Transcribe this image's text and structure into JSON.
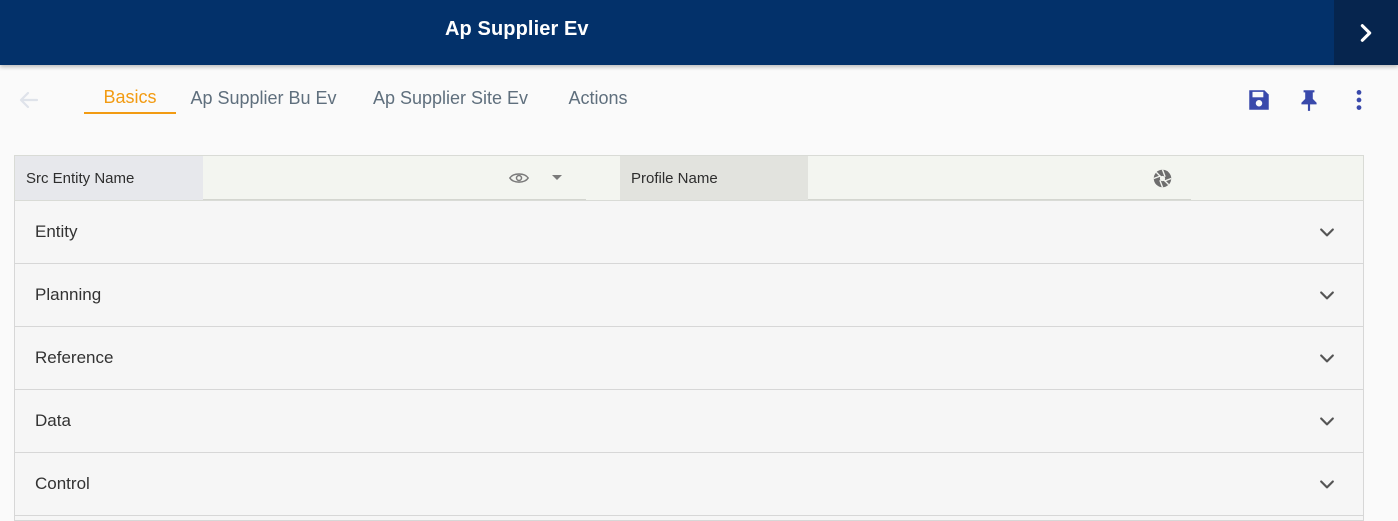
{
  "header": {
    "title": "Ap Supplier Ev",
    "next_icon": "chevron-right-icon"
  },
  "toolbar": {
    "back_icon": "arrow-left-icon",
    "tabs": [
      {
        "label": "Basics",
        "active": true
      },
      {
        "label": "Ap Supplier Bu Ev",
        "active": false
      },
      {
        "label": "Ap Supplier Site Ev",
        "active": false
      },
      {
        "label": "Actions",
        "active": false
      }
    ],
    "actions": [
      "save-icon",
      "pin-icon",
      "more-vert-icon"
    ]
  },
  "filters": {
    "src_entity_label": "Src Entity Name",
    "src_entity_value": "",
    "profile_label": "Profile Name",
    "profile_value": ""
  },
  "sections": [
    {
      "label": "Entity"
    },
    {
      "label": "Planning"
    },
    {
      "label": "Reference"
    },
    {
      "label": "Data"
    },
    {
      "label": "Control"
    }
  ],
  "colors": {
    "header_bg": "#03316a",
    "accent": "#f29b12",
    "icon_blue": "#3949ab",
    "tab_text": "#5f6f7d"
  }
}
